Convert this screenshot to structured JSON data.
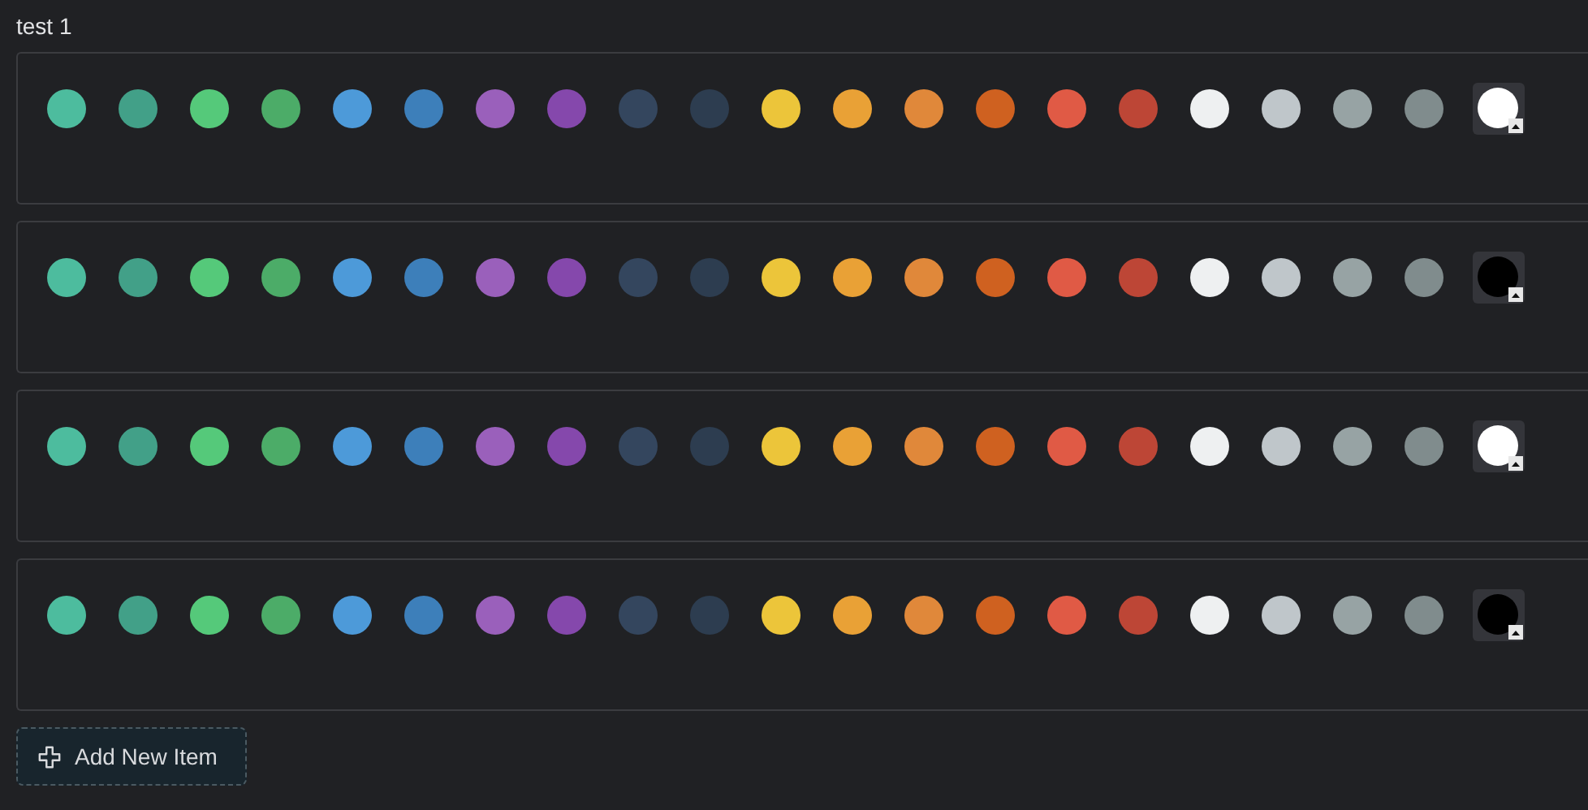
{
  "title": "test 1",
  "rows": [
    {
      "swatches": [
        {
          "color": "#4dbc9e"
        },
        {
          "color": "#42a088"
        },
        {
          "color": "#55c97a"
        },
        {
          "color": "#4cac68"
        },
        {
          "color": "#4d9ad9"
        },
        {
          "color": "#3d7fba"
        },
        {
          "color": "#9a60bb"
        },
        {
          "color": "#8548ac"
        },
        {
          "color": "#34465e"
        },
        {
          "color": "#2d3d50"
        },
        {
          "color": "#ecc53a"
        },
        {
          "color": "#e9a136"
        },
        {
          "color": "#e0883a"
        },
        {
          "color": "#cf6120"
        },
        {
          "color": "#e05a45"
        },
        {
          "color": "#bd4636"
        },
        {
          "color": "#eef0f1"
        },
        {
          "color": "#bfc6ca"
        },
        {
          "color": "#97a3a4"
        },
        {
          "color": "#808c8d"
        }
      ],
      "custom": {
        "color": "#ffffff"
      }
    },
    {
      "swatches": [
        {
          "color": "#4dbc9e"
        },
        {
          "color": "#42a088"
        },
        {
          "color": "#55c97a"
        },
        {
          "color": "#4cac68"
        },
        {
          "color": "#4d9ad9"
        },
        {
          "color": "#3d7fba"
        },
        {
          "color": "#9a60bb"
        },
        {
          "color": "#8548ac"
        },
        {
          "color": "#34465e"
        },
        {
          "color": "#2d3d50"
        },
        {
          "color": "#ecc53a"
        },
        {
          "color": "#e9a136"
        },
        {
          "color": "#e0883a"
        },
        {
          "color": "#cf6120"
        },
        {
          "color": "#e05a45"
        },
        {
          "color": "#bd4636"
        },
        {
          "color": "#eef0f1"
        },
        {
          "color": "#bfc6ca"
        },
        {
          "color": "#97a3a4"
        },
        {
          "color": "#808c8d"
        }
      ],
      "custom": {
        "color": "#000000"
      }
    },
    {
      "swatches": [
        {
          "color": "#4dbc9e"
        },
        {
          "color": "#42a088"
        },
        {
          "color": "#55c97a"
        },
        {
          "color": "#4cac68"
        },
        {
          "color": "#4d9ad9"
        },
        {
          "color": "#3d7fba"
        },
        {
          "color": "#9a60bb"
        },
        {
          "color": "#8548ac"
        },
        {
          "color": "#34465e"
        },
        {
          "color": "#2d3d50"
        },
        {
          "color": "#ecc53a"
        },
        {
          "color": "#e9a136"
        },
        {
          "color": "#e0883a"
        },
        {
          "color": "#cf6120"
        },
        {
          "color": "#e05a45"
        },
        {
          "color": "#bd4636"
        },
        {
          "color": "#eef0f1"
        },
        {
          "color": "#bfc6ca"
        },
        {
          "color": "#97a3a4"
        },
        {
          "color": "#808c8d"
        }
      ],
      "custom": {
        "color": "#ffffff"
      }
    },
    {
      "swatches": [
        {
          "color": "#4dbc9e"
        },
        {
          "color": "#42a088"
        },
        {
          "color": "#55c97a"
        },
        {
          "color": "#4cac68"
        },
        {
          "color": "#4d9ad9"
        },
        {
          "color": "#3d7fba"
        },
        {
          "color": "#9a60bb"
        },
        {
          "color": "#8548ac"
        },
        {
          "color": "#34465e"
        },
        {
          "color": "#2d3d50"
        },
        {
          "color": "#ecc53a"
        },
        {
          "color": "#e9a136"
        },
        {
          "color": "#e0883a"
        },
        {
          "color": "#cf6120"
        },
        {
          "color": "#e05a45"
        },
        {
          "color": "#bd4636"
        },
        {
          "color": "#eef0f1"
        },
        {
          "color": "#bfc6ca"
        },
        {
          "color": "#97a3a4"
        },
        {
          "color": "#808c8d"
        }
      ],
      "custom": {
        "color": "#000000"
      }
    }
  ],
  "add_button": "Add New Item"
}
